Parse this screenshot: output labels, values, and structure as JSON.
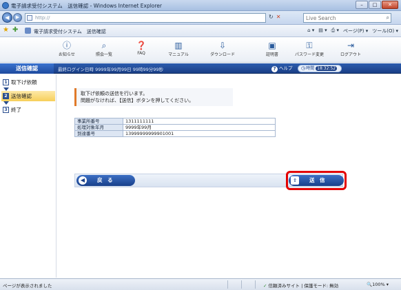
{
  "window": {
    "title": "電子請求受付システム　送信確認 - Windows Internet Explorer",
    "min_glyph": "–",
    "max_glyph": "□",
    "close_glyph": "✕"
  },
  "address": {
    "url": "http://",
    "search_placeholder": "Live Search",
    "refresh_glyph": "↻",
    "stop_glyph": "✕"
  },
  "favorites": {
    "tab_label": "電子請求受付システム　送信確認",
    "tools": [
      "⌂ ▾",
      "▤ ▾",
      "⎙ ▾",
      "ページ(P) ▾",
      "ツール(O) ▾"
    ]
  },
  "toolbar": {
    "items": [
      {
        "label": "お知らせ",
        "icon": "ⓘ"
      },
      {
        "label": "照会一覧",
        "icon": "⌕"
      },
      {
        "label": "FAQ",
        "icon": "❓"
      },
      {
        "label": "マニュアル",
        "icon": "▥"
      },
      {
        "label": "ダウンロード",
        "icon": "⇩"
      },
      {
        "label": "証明書",
        "icon": "▣"
      },
      {
        "label": "パスワード変更",
        "icon": "⚿"
      },
      {
        "label": "ログアウト",
        "icon": "⇥"
      }
    ]
  },
  "infostrip": {
    "screen_title": "送信確認",
    "login_info": "最終ログイン日時 9999年99月99日 99時99分99秒",
    "help_label": "ヘルプ",
    "timer_label": "時間",
    "timer_value": "18:32:52"
  },
  "steps": [
    {
      "num": "1",
      "label": "取下げ依頼",
      "active": false
    },
    {
      "num": "2",
      "label": "送信確認",
      "active": true
    },
    {
      "num": "3",
      "label": "終了",
      "active": false
    }
  ],
  "message": {
    "line1": "取下げ依頼の送信を行います。",
    "line2": "問題がなければ、【送信】ボタンを押してください。"
  },
  "details": {
    "rows": [
      {
        "header": "事業所番号",
        "value": "1311111111"
      },
      {
        "header": "処理対象年月",
        "value": "9999年99月"
      },
      {
        "header": "到達番号",
        "value": "13999999999901001"
      }
    ]
  },
  "actions": {
    "back_label": "戻　る",
    "send_label": "送　信"
  },
  "statusbar": {
    "status_text": "ページが表示されました",
    "zone_text": "信頼済みサイト | 保護モード: 無効",
    "zoom_text": "100%",
    "zoom_prefix": "🔍"
  }
}
